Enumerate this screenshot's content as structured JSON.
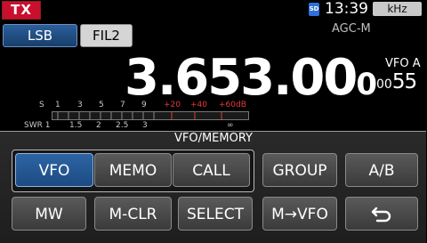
{
  "status_bar": {
    "tx": "TX",
    "sd": "SD",
    "time": "13:39",
    "unit": "kHz"
  },
  "mode_bar": {
    "mode": "LSB",
    "filter": "FIL2",
    "agc": "AGC-M"
  },
  "frequency": {
    "main": "3.653.00",
    "sub_digit": "0",
    "vfo_label": "VFO A",
    "rit_prefix": "00",
    "rit_digits": "55"
  },
  "meter": {
    "s_label": "S",
    "s_scale": [
      "1",
      "3",
      "5",
      "7",
      "9"
    ],
    "plus_scale": [
      "+20",
      "+40",
      "+60dB"
    ],
    "swr_label": "SWR",
    "swr_scale": [
      "1",
      "1.5",
      "2",
      "2.5",
      "3",
      "∞"
    ],
    "level_fraction": 0.0
  },
  "panel": {
    "title": "VFO/MEMORY",
    "row1": [
      "VFO",
      "MEMO",
      "CALL",
      "GROUP",
      "A/B"
    ],
    "row2": [
      "MW",
      "M-CLR",
      "SELECT",
      "M→VFO"
    ],
    "selected": "VFO",
    "back_icon": "return-icon"
  },
  "colors": {
    "tx_red": "#c8102e",
    "selected_blue": "#2e64a4",
    "meter_red": "#e23b3b"
  }
}
